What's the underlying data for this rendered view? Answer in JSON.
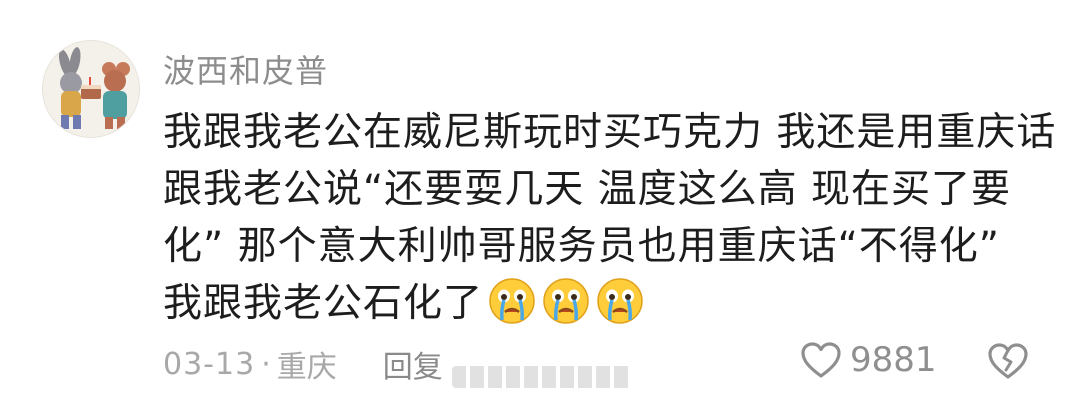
{
  "comment": {
    "username": "波西和皮普",
    "content_lines": [
      "我跟我老公在威尼斯玩时买巧克力 我还是用重庆话",
      "跟我老公说“还要耍几天 温度这么高 现在买了要",
      "化” 那个意大利帅哥服务员也用重庆话“不得化”",
      "我跟我老公石化了"
    ],
    "emojis": [
      "crying-face-icon",
      "crying-face-icon",
      "crying-face-icon"
    ],
    "date": "03-13",
    "separator": "·",
    "location": "重庆",
    "reply_label": "回复",
    "like_count": "9881"
  },
  "colors": {
    "username": "#8d8d8d",
    "content": "#1d1d1d",
    "meta": "#a8a8a8",
    "icon_stroke": "#8f8f8f",
    "emoji_face": "#ffcc3a"
  }
}
